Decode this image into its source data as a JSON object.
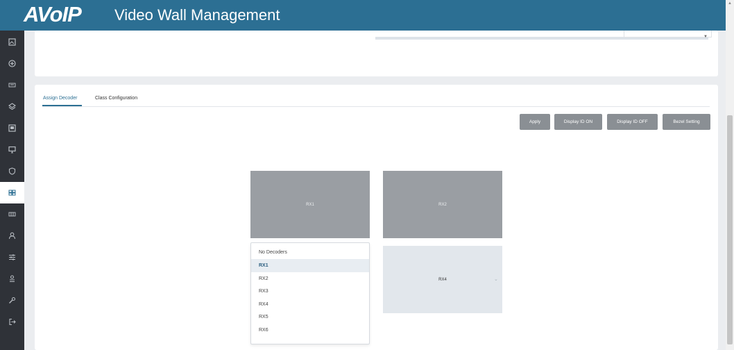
{
  "header": {
    "logo": "AVoIP",
    "title": "Video Wall Management",
    "background": "#2c6f93"
  },
  "sidebar": {
    "background": "#2f3238",
    "items": [
      {
        "icon": "image-icon",
        "active": false
      },
      {
        "icon": "circle-plus-icon",
        "active": false
      },
      {
        "icon": "keyboard-icon",
        "active": false
      },
      {
        "icon": "layers-icon",
        "active": false
      },
      {
        "icon": "display-icon",
        "active": false
      },
      {
        "icon": "monitor-icon",
        "active": false
      },
      {
        "icon": "shield-icon",
        "active": false
      },
      {
        "icon": "video-wall-icon",
        "active": true
      },
      {
        "icon": "grid-icon",
        "active": false
      },
      {
        "icon": "user-icon",
        "active": false
      },
      {
        "icon": "sliders-icon",
        "active": false
      },
      {
        "icon": "user-gear-icon",
        "active": false
      },
      {
        "icon": "wrench-icon",
        "active": false
      },
      {
        "icon": "logout-icon",
        "active": false
      }
    ]
  },
  "tabs": [
    {
      "label": "Assign Decoder",
      "active": true
    },
    {
      "label": "Class Configuration",
      "active": false
    }
  ],
  "toolbar": {
    "apply": "Apply",
    "display_on": "Display ID ON",
    "display_off": "Display ID OFF",
    "bezel": "Bezel Setting"
  },
  "wall": {
    "screens": [
      {
        "label": "RX1"
      },
      {
        "label": "RX2"
      },
      {
        "label": "RX4"
      }
    ]
  },
  "dropdown": {
    "options": [
      "No Decoders",
      "RX1",
      "RX2",
      "RX3",
      "RX4",
      "RX5",
      "RX6"
    ],
    "selected": "RX1"
  },
  "colors": {
    "accent": "#2c6f93",
    "button": "#8a8f94",
    "screen": "#9a9ea3"
  }
}
